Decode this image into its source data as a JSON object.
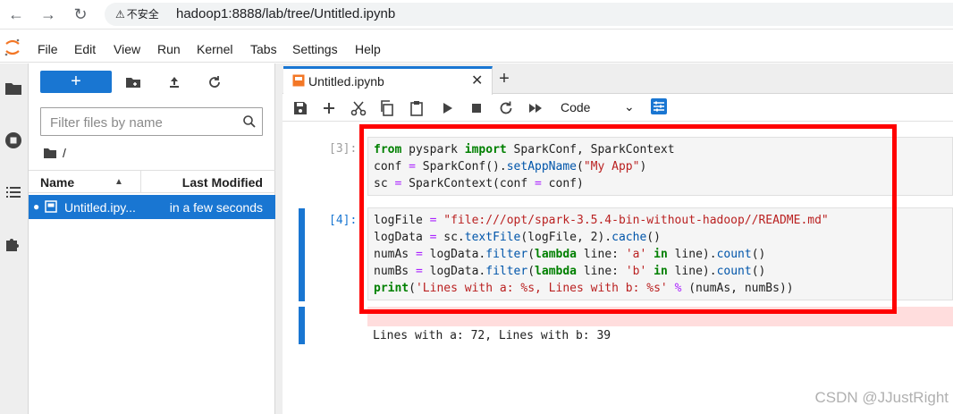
{
  "browser": {
    "back_icon": "arrow-left-icon",
    "forward_icon": "arrow-right-icon",
    "reload_icon": "reload-icon",
    "security_label": "不安全",
    "url": "hadoop1:8888/lab/tree/Untitled.ipynb"
  },
  "menu": {
    "items": [
      "File",
      "Edit",
      "View",
      "Run",
      "Kernel",
      "Tabs",
      "Settings",
      "Help"
    ]
  },
  "activity_bar": {
    "icons": [
      "folder-icon",
      "stop-circle-icon",
      "list-icon",
      "puzzle-icon"
    ]
  },
  "file_browser": {
    "new_label": "+",
    "filter_placeholder": "Filter files by name",
    "breadcrumb": "/",
    "columns": {
      "name": "Name",
      "modified": "Last Modified"
    },
    "files": [
      {
        "name": "Untitled.ipy...",
        "modified": "in a few seconds",
        "selected": true
      }
    ]
  },
  "notebook": {
    "tab_label": "Untitled.ipynb",
    "cell_type": "Code",
    "accent_color": "#1976d2",
    "cells": [
      {
        "prompt": "[3]:",
        "lines": [
          "from pyspark import SparkConf, SparkContext",
          "conf = SparkConf().setAppName(\"My App\")",
          "sc = SparkContext(conf = conf)"
        ]
      },
      {
        "prompt": "[4]:",
        "lines": [
          "logFile = \"file:///opt/spark-3.5.4-bin-without-hadoop//README.md\"",
          "logData = sc.textFile(logFile, 2).cache()",
          "numAs = logData.filter(lambda line: 'a' in line).count()",
          "numBs = logData.filter(lambda line: 'b' in line).count()",
          "print('Lines with a: %s, Lines with b: %s' % (numAs, numBs))"
        ],
        "output": "Lines with a: 72, Lines with b: 39"
      }
    ]
  },
  "highlight_color": "#ff0000",
  "watermark": "CSDN @JJustRight"
}
